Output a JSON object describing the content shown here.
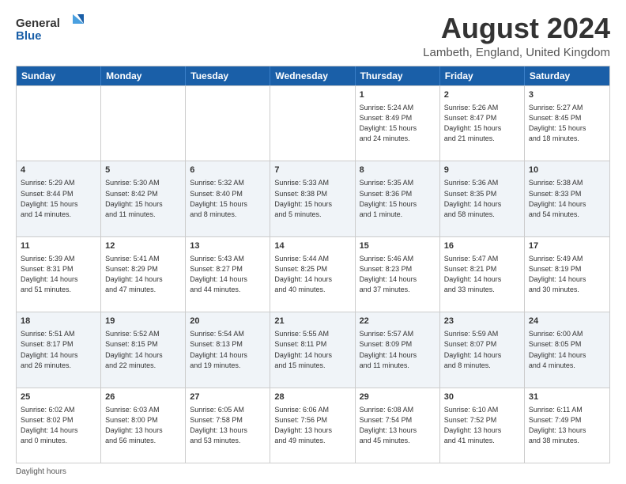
{
  "logo": {
    "line1": "General",
    "line2": "Blue"
  },
  "title": "August 2024",
  "subtitle": "Lambeth, England, United Kingdom",
  "days": [
    "Sunday",
    "Monday",
    "Tuesday",
    "Wednesday",
    "Thursday",
    "Friday",
    "Saturday"
  ],
  "rows": [
    [
      {
        "num": "",
        "text": "",
        "empty": true
      },
      {
        "num": "",
        "text": "",
        "empty": true
      },
      {
        "num": "",
        "text": "",
        "empty": true
      },
      {
        "num": "",
        "text": "",
        "empty": true
      },
      {
        "num": "1",
        "text": "Sunrise: 5:24 AM\nSunset: 8:49 PM\nDaylight: 15 hours\nand 24 minutes.",
        "empty": false
      },
      {
        "num": "2",
        "text": "Sunrise: 5:26 AM\nSunset: 8:47 PM\nDaylight: 15 hours\nand 21 minutes.",
        "empty": false
      },
      {
        "num": "3",
        "text": "Sunrise: 5:27 AM\nSunset: 8:45 PM\nDaylight: 15 hours\nand 18 minutes.",
        "empty": false
      }
    ],
    [
      {
        "num": "4",
        "text": "Sunrise: 5:29 AM\nSunset: 8:44 PM\nDaylight: 15 hours\nand 14 minutes.",
        "empty": false
      },
      {
        "num": "5",
        "text": "Sunrise: 5:30 AM\nSunset: 8:42 PM\nDaylight: 15 hours\nand 11 minutes.",
        "empty": false
      },
      {
        "num": "6",
        "text": "Sunrise: 5:32 AM\nSunset: 8:40 PM\nDaylight: 15 hours\nand 8 minutes.",
        "empty": false
      },
      {
        "num": "7",
        "text": "Sunrise: 5:33 AM\nSunset: 8:38 PM\nDaylight: 15 hours\nand 5 minutes.",
        "empty": false
      },
      {
        "num": "8",
        "text": "Sunrise: 5:35 AM\nSunset: 8:36 PM\nDaylight: 15 hours\nand 1 minute.",
        "empty": false
      },
      {
        "num": "9",
        "text": "Sunrise: 5:36 AM\nSunset: 8:35 PM\nDaylight: 14 hours\nand 58 minutes.",
        "empty": false
      },
      {
        "num": "10",
        "text": "Sunrise: 5:38 AM\nSunset: 8:33 PM\nDaylight: 14 hours\nand 54 minutes.",
        "empty": false
      }
    ],
    [
      {
        "num": "11",
        "text": "Sunrise: 5:39 AM\nSunset: 8:31 PM\nDaylight: 14 hours\nand 51 minutes.",
        "empty": false
      },
      {
        "num": "12",
        "text": "Sunrise: 5:41 AM\nSunset: 8:29 PM\nDaylight: 14 hours\nand 47 minutes.",
        "empty": false
      },
      {
        "num": "13",
        "text": "Sunrise: 5:43 AM\nSunset: 8:27 PM\nDaylight: 14 hours\nand 44 minutes.",
        "empty": false
      },
      {
        "num": "14",
        "text": "Sunrise: 5:44 AM\nSunset: 8:25 PM\nDaylight: 14 hours\nand 40 minutes.",
        "empty": false
      },
      {
        "num": "15",
        "text": "Sunrise: 5:46 AM\nSunset: 8:23 PM\nDaylight: 14 hours\nand 37 minutes.",
        "empty": false
      },
      {
        "num": "16",
        "text": "Sunrise: 5:47 AM\nSunset: 8:21 PM\nDaylight: 14 hours\nand 33 minutes.",
        "empty": false
      },
      {
        "num": "17",
        "text": "Sunrise: 5:49 AM\nSunset: 8:19 PM\nDaylight: 14 hours\nand 30 minutes.",
        "empty": false
      }
    ],
    [
      {
        "num": "18",
        "text": "Sunrise: 5:51 AM\nSunset: 8:17 PM\nDaylight: 14 hours\nand 26 minutes.",
        "empty": false
      },
      {
        "num": "19",
        "text": "Sunrise: 5:52 AM\nSunset: 8:15 PM\nDaylight: 14 hours\nand 22 minutes.",
        "empty": false
      },
      {
        "num": "20",
        "text": "Sunrise: 5:54 AM\nSunset: 8:13 PM\nDaylight: 14 hours\nand 19 minutes.",
        "empty": false
      },
      {
        "num": "21",
        "text": "Sunrise: 5:55 AM\nSunset: 8:11 PM\nDaylight: 14 hours\nand 15 minutes.",
        "empty": false
      },
      {
        "num": "22",
        "text": "Sunrise: 5:57 AM\nSunset: 8:09 PM\nDaylight: 14 hours\nand 11 minutes.",
        "empty": false
      },
      {
        "num": "23",
        "text": "Sunrise: 5:59 AM\nSunset: 8:07 PM\nDaylight: 14 hours\nand 8 minutes.",
        "empty": false
      },
      {
        "num": "24",
        "text": "Sunrise: 6:00 AM\nSunset: 8:05 PM\nDaylight: 14 hours\nand 4 minutes.",
        "empty": false
      }
    ],
    [
      {
        "num": "25",
        "text": "Sunrise: 6:02 AM\nSunset: 8:02 PM\nDaylight: 14 hours\nand 0 minutes.",
        "empty": false
      },
      {
        "num": "26",
        "text": "Sunrise: 6:03 AM\nSunset: 8:00 PM\nDaylight: 13 hours\nand 56 minutes.",
        "empty": false
      },
      {
        "num": "27",
        "text": "Sunrise: 6:05 AM\nSunset: 7:58 PM\nDaylight: 13 hours\nand 53 minutes.",
        "empty": false
      },
      {
        "num": "28",
        "text": "Sunrise: 6:06 AM\nSunset: 7:56 PM\nDaylight: 13 hours\nand 49 minutes.",
        "empty": false
      },
      {
        "num": "29",
        "text": "Sunrise: 6:08 AM\nSunset: 7:54 PM\nDaylight: 13 hours\nand 45 minutes.",
        "empty": false
      },
      {
        "num": "30",
        "text": "Sunrise: 6:10 AM\nSunset: 7:52 PM\nDaylight: 13 hours\nand 41 minutes.",
        "empty": false
      },
      {
        "num": "31",
        "text": "Sunrise: 6:11 AM\nSunset: 7:49 PM\nDaylight: 13 hours\nand 38 minutes.",
        "empty": false
      }
    ]
  ],
  "footer": "Daylight hours"
}
